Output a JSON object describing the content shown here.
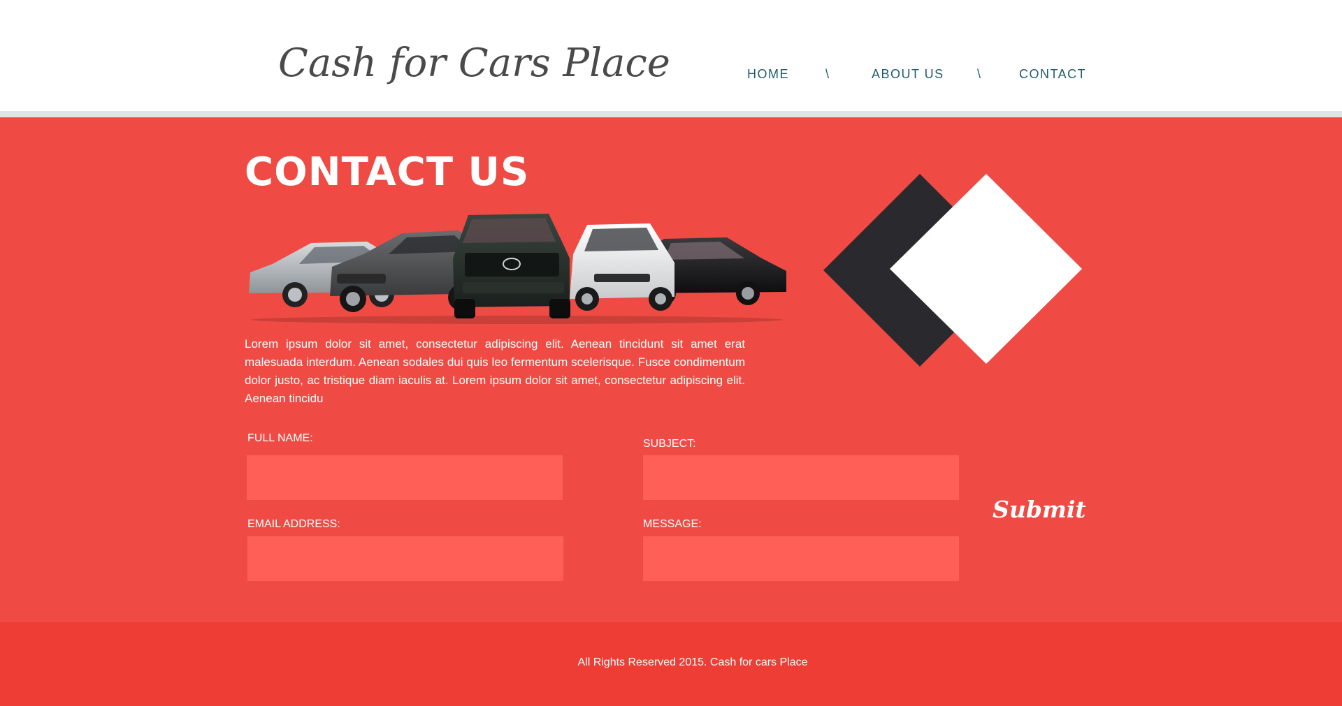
{
  "header": {
    "logo_text": "Cash for Cars Place",
    "nav": {
      "home": "HOME",
      "about": "ABOUT US",
      "contact": "CONTACT",
      "separator": "\\"
    }
  },
  "main": {
    "title": "CONTACT US",
    "intro": "Lorem ipsum dolor sit amet, consectetur adipiscing elit. Aenean tincidunt sit amet erat malesuada interdum. Aenean sodales dui quis leo fermentum scelerisque. Fusce condimentum dolor justo, ac tristique diam iaculis at. Lorem ipsum dolor sit amet, consectetur adipiscing elit. Aenean tincidu",
    "image_icon": "cars-lineup-image",
    "decor_icon": "diamond-logo-icon"
  },
  "form": {
    "full_name_label": "FULL NAME:",
    "full_name_value": "",
    "subject_label": "SUBJECT:",
    "subject_value": "",
    "email_label": "EMAIL ADDRESS:",
    "email_value": "",
    "message_label": "MESSAGE:",
    "message_value": "",
    "submit_label": "Submit"
  },
  "footer": {
    "copyright": "All Rights Reserved 2015. Cash for cars Place"
  },
  "colors": {
    "page_bg": "#ef4b44",
    "header_bg": "#ffffff",
    "header_rule": "#e3e4e6",
    "logo": "#4a4a4a",
    "nav": "#1f5b70",
    "input_bg": "#ff5f57",
    "footer_bg": "#ee3d35",
    "diamond_dark": "#2a2a2e",
    "diamond_light": "#ffffff"
  }
}
